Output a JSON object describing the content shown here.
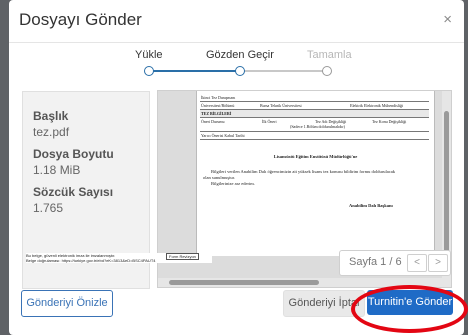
{
  "modal": {
    "title": "Dosyayı Gönder",
    "close": "×"
  },
  "stepper": {
    "steps": [
      "Yükle",
      "Gözden Geçir",
      "Tamamla"
    ]
  },
  "file": {
    "title_label": "Başlık",
    "title_value": "tez.pdf",
    "size_label": "Dosya Boyutu",
    "size_value": "1.18 MiB",
    "words_label": "Sözcük Sayısı",
    "words_value": "1.765"
  },
  "document": {
    "row1": "İkinci Tez Danışmanı",
    "row2a": "Üniversitesi/Bölümü",
    "row2b": "Bursa Teknik Üniversitesi",
    "row2c": "Elektrik Elektronik Mühendisliği",
    "section": "TEZ BİLGİLERİ",
    "row4a": "Öneri Durumu",
    "row4b": "İlk Öneri",
    "row4c": "Tez Adı Değişikliği",
    "row4d": "(Sadece 1.Bölüm doldurulmalıdır)",
    "row4e": "Tez Konu Değişikliği",
    "row5": "Yarıcı Önerisi Kabul Tarihi",
    "heading": "Lisansüstü Eğitim Enstitüsü Müdürlüğü'ne",
    "body1": "Bilgileri verilen Anabilim Dalı öğrencimizin ait yüksek lisans tez konusu bildirim formu doldurulacak",
    "body2": "olan sunulmuştur.",
    "body3": "Bilgilerinize arz ederim.",
    "signature": "Anabilim Dalı Başkanı",
    "footer1": "Bu belge, güvenli elektronik imza ile imzalanmıştır.",
    "footer2": "Belge doğrulaması: https://turkiye.gov.tr/ebd?eK=3813&eD=BSC4PAUT4",
    "form_rev": "Form Revizyon"
  },
  "pager": {
    "text": "Sayfa 1 / 6",
    "prev": "<",
    "next": ">"
  },
  "footer": {
    "preview_button": "Gönderiyi Önizle",
    "cancel_button": "Gönderiyi İptal",
    "submit_button": "Turnitin'e Gönder"
  },
  "colors": {
    "primary": "#1f6bc6",
    "highlight_ring": "#e30613",
    "step_active": "#2a6fa8"
  }
}
